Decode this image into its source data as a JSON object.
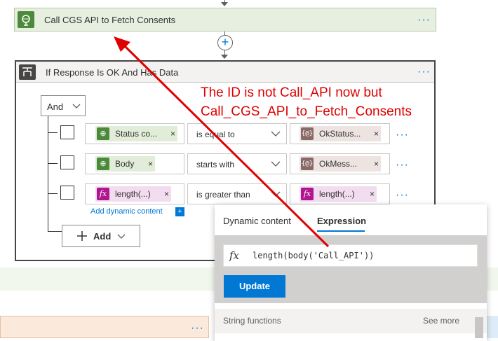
{
  "top_action": {
    "title": "Call CGS API to Fetch Consents",
    "more_label": "···"
  },
  "insert_button_label": "+",
  "condition": {
    "title": "If Response Is OK And Has Data",
    "more_label": "···",
    "group_operator": "And",
    "rows": [
      {
        "left_token": "Status co...",
        "left_token_kind": "green",
        "operator": "is equal to",
        "right_token": "OkStatus...",
        "right_token_kind": "brown"
      },
      {
        "left_token": "Body",
        "left_token_kind": "green",
        "operator": "starts with",
        "right_token": "OkMess...",
        "right_token_kind": "brown"
      },
      {
        "left_token": "length(...)",
        "left_token_kind": "pink",
        "operator": "is greater than",
        "right_token": "length(...)",
        "right_token_kind": "pink"
      }
    ],
    "add_dynamic_content_label": "Add dynamic content",
    "add_button_label": "Add"
  },
  "popup": {
    "tabs": [
      "Dynamic content",
      "Expression"
    ],
    "active_tab": "Expression",
    "fx_label": "fx",
    "expression_value": "length(body('Call_API'))",
    "update_label": "Update",
    "section_label": "String functions",
    "see_more_label": "See more"
  },
  "annotation": {
    "line1": "The ID is not Call_API now but",
    "line2": "Call_CGS_API_to_Fetch_Consents",
    "color": "#e00000"
  },
  "colors": {
    "accent": "#0078d4",
    "action_header": "#e7efe0",
    "expression_token": "#b0168f"
  }
}
